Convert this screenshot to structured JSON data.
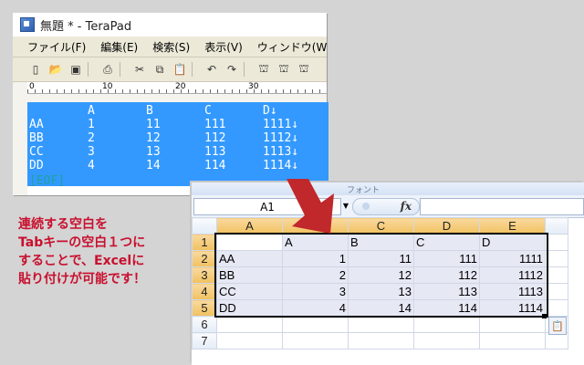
{
  "terapad": {
    "title": "無題 * - TeraPad",
    "menu": [
      "ファイル(F)",
      "編集(E)",
      "検索(S)",
      "表示(V)",
      "ウィンドウ(W"
    ],
    "toolbar_icons": [
      "new-file-icon",
      "open-folder-icon",
      "save-icon",
      "print-icon",
      "cut-icon",
      "copy-icon",
      "paste-icon",
      "undo-icon",
      "redo-icon",
      "find-icon",
      "find-next-icon",
      "replace-icon"
    ],
    "ruler": [
      "0",
      "10",
      "20",
      "30"
    ],
    "lines": [
      [
        "",
        "A",
        "B",
        "C",
        "D↓"
      ],
      [
        "AA",
        "1",
        "11",
        "111",
        "1111↓"
      ],
      [
        "BB",
        "2",
        "12",
        "112",
        "1112↓"
      ],
      [
        "CC",
        "3",
        "13",
        "113",
        "1113↓"
      ],
      [
        "DD",
        "4",
        "14",
        "114",
        "1114↓"
      ]
    ],
    "eof": "[EOF]",
    "selection_color": "#3399ff"
  },
  "excel": {
    "ribbon_text": "フォント",
    "name_box": "A1",
    "fx_label": "fx",
    "columns": [
      "A",
      "B",
      "C",
      "D",
      "E"
    ],
    "rows": [
      [
        "",
        "A",
        "B",
        "C",
        "D"
      ],
      [
        "AA",
        "1",
        "11",
        "111",
        "1111"
      ],
      [
        "BB",
        "2",
        "12",
        "112",
        "1112"
      ],
      [
        "CC",
        "3",
        "13",
        "113",
        "1113"
      ],
      [
        "DD",
        "4",
        "14",
        "114",
        "1114"
      ],
      [
        "",
        "",
        "",
        "",
        ""
      ],
      [
        "",
        "",
        "",
        "",
        ""
      ]
    ],
    "row_numbers": [
      "1",
      "2",
      "3",
      "4",
      "5",
      "6",
      "7"
    ]
  },
  "caption": {
    "lines": [
      "連続する空白を",
      "Tabキーの空白１つに",
      "することで、Excelに",
      "貼り付けが可能です！"
    ],
    "color": "#c8102e"
  },
  "arrow_color": "#c0282b"
}
